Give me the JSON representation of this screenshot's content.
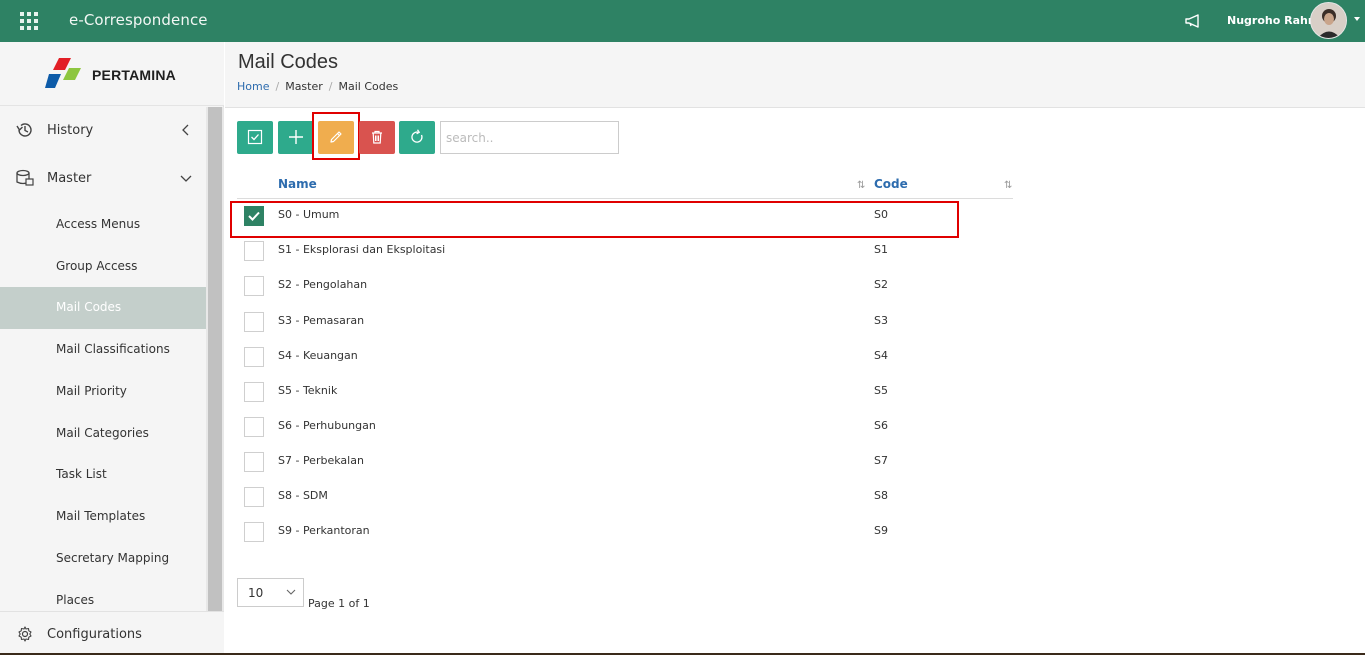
{
  "app": {
    "title": "e-Correspondence"
  },
  "header": {
    "user_name": "Nugroho Rahm"
  },
  "sidebar": {
    "logo_text": "PERTAMINA",
    "groups": [
      {
        "label": "History",
        "icon": "history-icon"
      },
      {
        "label": "Master",
        "icon": "database-icon"
      }
    ],
    "items": [
      {
        "label": "Access Menus"
      },
      {
        "label": "Group Access"
      },
      {
        "label": "Mail Codes"
      },
      {
        "label": "Mail Classifications"
      },
      {
        "label": "Mail Priority"
      },
      {
        "label": "Mail Categories"
      },
      {
        "label": "Task List"
      },
      {
        "label": "Mail Templates"
      },
      {
        "label": "Secretary Mapping"
      },
      {
        "label": "Places"
      }
    ],
    "active_item": "Mail Codes",
    "config_label": "Configurations"
  },
  "page": {
    "title": "Mail Codes",
    "breadcrumb": [
      "Home",
      "Master",
      "Mail Codes"
    ]
  },
  "toolbar": {
    "search_placeholder": "search.."
  },
  "table": {
    "columns": [
      "Name",
      "Code"
    ],
    "rows": [
      {
        "name": "S0 - Umum",
        "code": "S0",
        "checked": true
      },
      {
        "name": "S1 - Eksplorasi dan Eksploitasi",
        "code": "S1",
        "checked": false
      },
      {
        "name": "S2 - Pengolahan",
        "code": "S2",
        "checked": false
      },
      {
        "name": "S3 - Pemasaran",
        "code": "S3",
        "checked": false
      },
      {
        "name": "S4 - Keuangan",
        "code": "S4",
        "checked": false
      },
      {
        "name": "S5 - Teknik",
        "code": "S5",
        "checked": false
      },
      {
        "name": "S6 - Perhubungan",
        "code": "S6",
        "checked": false
      },
      {
        "name": "S7 - Perbekalan",
        "code": "S7",
        "checked": false
      },
      {
        "name": "S8 - SDM",
        "code": "S8",
        "checked": false
      },
      {
        "name": "S9 - Perkantoran",
        "code": "S9",
        "checked": false
      }
    ]
  },
  "pagination": {
    "page_size": "10",
    "page_info": "Page 1 of 1"
  },
  "colors": {
    "topbar": "#2e8264",
    "primary_button": "#2eaa8c",
    "edit_button": "#f0ad4e",
    "delete_button": "#d9534f",
    "link": "#2d6cae",
    "highlight": "#e00000"
  }
}
